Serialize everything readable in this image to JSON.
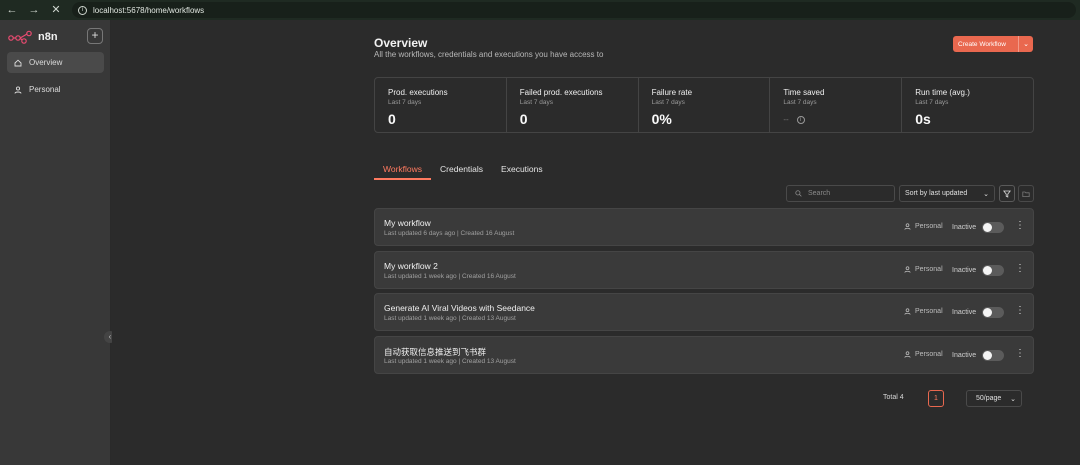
{
  "browser": {
    "url": "localhost:5678/home/workflows"
  },
  "sidebar": {
    "brand": "n8n",
    "add_label": "+",
    "items": [
      {
        "label": "Overview",
        "icon": "home-icon",
        "active": true
      },
      {
        "label": "Personal",
        "icon": "user-icon",
        "active": false
      }
    ]
  },
  "header": {
    "title": "Overview",
    "subtitle": "All the workflows, credentials and executions you have access to",
    "create_label": "Create Workflow"
  },
  "stats": [
    {
      "label": "Prod. executions",
      "sub": "Last 7 days",
      "value": "0"
    },
    {
      "label": "Failed prod. executions",
      "sub": "Last 7 days",
      "value": "0"
    },
    {
      "label": "Failure rate",
      "sub": "Last 7 days",
      "value": "0%"
    },
    {
      "label": "Time saved",
      "sub": "Last 7 days",
      "value": "--"
    },
    {
      "label": "Run time (avg.)",
      "sub": "Last 7 days",
      "value": "0s"
    }
  ],
  "tabs": [
    {
      "label": "Workflows",
      "active": true
    },
    {
      "label": "Credentials",
      "active": false
    },
    {
      "label": "Executions",
      "active": false
    }
  ],
  "toolbar": {
    "search_placeholder": "Search",
    "sort_value": "Sort by last updated"
  },
  "workflows": [
    {
      "name": "My workflow",
      "meta": "Last updated 6 days ago | Created 16 August",
      "owner": "Personal",
      "status": "Inactive"
    },
    {
      "name": "My workflow 2",
      "meta": "Last updated 1 week ago | Created 16 August",
      "owner": "Personal",
      "status": "Inactive"
    },
    {
      "name": "Generate AI Viral Videos with Seedance",
      "meta": "Last updated 1 week ago | Created 13 August",
      "owner": "Personal",
      "status": "Inactive"
    },
    {
      "name": "自动获取信息推送到飞书群",
      "meta": "Last updated 1 week ago | Created 13 August",
      "owner": "Personal",
      "status": "Inactive"
    }
  ],
  "pagination": {
    "total": "Total 4",
    "current_page": "1",
    "per_page": "50/page"
  },
  "colors": {
    "accent": "#e9684f",
    "background": "#2b2b2b",
    "sidebar": "#383838"
  }
}
